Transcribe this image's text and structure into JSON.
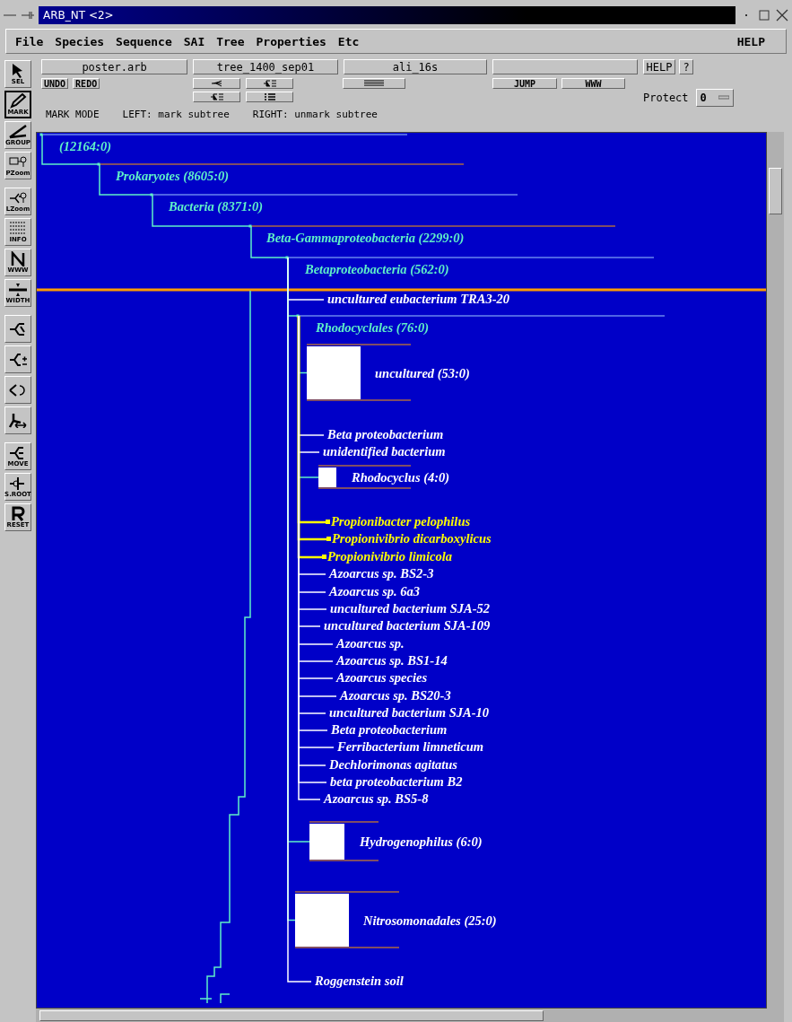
{
  "window": {
    "title": "ARB_NT <2>"
  },
  "menu": [
    {
      "label": "File"
    },
    {
      "label": "Species"
    },
    {
      "label": "Sequence"
    },
    {
      "label": "SAI"
    },
    {
      "label": "Tree"
    },
    {
      "label": "Properties"
    },
    {
      "label": "Etc"
    }
  ],
  "help_menu": "HELP",
  "tools": [
    {
      "kind": "select",
      "label": "SEL",
      "selected": false
    },
    {
      "kind": "mark",
      "label": "MARK",
      "selected": true
    },
    {
      "kind": "group",
      "label": "GROUP",
      "selected": false
    },
    {
      "kind": "pzoom",
      "label": "PZoom",
      "selected": false
    },
    {
      "kind": "lzoom",
      "label": "LZoom",
      "selected": false
    },
    {
      "kind": "info",
      "label": "INFO",
      "selected": false
    },
    {
      "kind": "www",
      "label": "WWW",
      "selected": false
    },
    {
      "kind": "width",
      "label": "WIDTH",
      "selected": false
    },
    {
      "kind": "swap",
      "selected": false
    },
    {
      "kind": "length",
      "selected": false
    },
    {
      "kind": "rotate",
      "selected": false
    },
    {
      "kind": "flip",
      "selected": false
    },
    {
      "kind": "move",
      "label": "MOVE",
      "selected": false
    },
    {
      "kind": "setroot",
      "label": "S.ROOT",
      "selected": false
    },
    {
      "kind": "reset",
      "label": "RESET",
      "selected": false
    }
  ],
  "toolbar": {
    "database": "poster.arb",
    "tree": "tree_1400_sep01",
    "alignment": "ali_16s",
    "help": "HELP",
    "question": "?",
    "undo": "UNDO",
    "redo": "REDO",
    "jump": "JUMP",
    "www": "WWW",
    "protect_label": "Protect",
    "protect_value": "0"
  },
  "status": {
    "mode": "MARK MODE",
    "left": "LEFT: mark subtree",
    "right": "RIGHT: unmark subtree"
  },
  "tree": {
    "kind": "group",
    "label": "(12164:0)",
    "children": [
      {
        "kind": "group",
        "label": "Prokaryotes (8605:0)",
        "children": [
          {
            "kind": "group",
            "label": "Bacteria (8371:0)",
            "children": [
              {
                "kind": "group",
                "label": "Beta-Gammaproteobacteria (2299:0)",
                "children": [
                  {
                    "kind": "group",
                    "label": "Betaproteobacteria (562:0)",
                    "children": [
                      {
                        "kind": "leaf",
                        "label": "uncultured eubacterium TRA3-20",
                        "marked": false
                      },
                      {
                        "kind": "group",
                        "label": "Rhodocyclales (76:0)",
                        "children": [
                          {
                            "kind": "collapsed",
                            "label": "uncultured (53:0)"
                          },
                          {
                            "kind": "leaf",
                            "label": "Beta proteobacterium",
                            "marked": false
                          },
                          {
                            "kind": "leaf",
                            "label": "unidentified bacterium",
                            "marked": false
                          },
                          {
                            "kind": "collapsed",
                            "label": "Rhodocyclus (4:0)"
                          },
                          {
                            "kind": "leaf",
                            "label": "Propionibacter pelophilus",
                            "marked": true
                          },
                          {
                            "kind": "leaf",
                            "label": "Propionivibrio dicarboxylicus",
                            "marked": true
                          },
                          {
                            "kind": "leaf",
                            "label": "Propionivibrio limicola",
                            "marked": true
                          },
                          {
                            "kind": "leaf",
                            "label": "Azoarcus sp. BS2-3",
                            "marked": false
                          },
                          {
                            "kind": "leaf",
                            "label": "Azoarcus sp. 6a3",
                            "marked": false
                          },
                          {
                            "kind": "leaf",
                            "label": "uncultured bacterium SJA-52",
                            "marked": false
                          },
                          {
                            "kind": "leaf",
                            "label": "uncultured bacterium SJA-109",
                            "marked": false
                          },
                          {
                            "kind": "leaf",
                            "label": "Azoarcus sp.",
                            "marked": false
                          },
                          {
                            "kind": "leaf",
                            "label": "Azoarcus sp. BS1-14",
                            "marked": false
                          },
                          {
                            "kind": "leaf",
                            "label": "Azoarcus species",
                            "marked": false
                          },
                          {
                            "kind": "leaf",
                            "label": "Azoarcus sp. BS20-3",
                            "marked": false
                          },
                          {
                            "kind": "leaf",
                            "label": "uncultured bacterium SJA-10",
                            "marked": false
                          },
                          {
                            "kind": "leaf",
                            "label": "Beta proteobacterium",
                            "marked": false
                          },
                          {
                            "kind": "leaf",
                            "label": "Ferribacterium limneticum",
                            "marked": false
                          },
                          {
                            "kind": "leaf",
                            "label": "Dechlorimonas agitatus",
                            "marked": false
                          },
                          {
                            "kind": "leaf",
                            "label": "beta proteobacterium B2",
                            "marked": false
                          },
                          {
                            "kind": "leaf",
                            "label": "Azoarcus sp. BS5-8",
                            "marked": false
                          }
                        ]
                      },
                      {
                        "kind": "collapsed",
                        "label": "Hydrogenophilus (6:0)"
                      },
                      {
                        "kind": "collapsed",
                        "label": "Nitrosomonadales (25:0)"
                      },
                      {
                        "kind": "leaf",
                        "label": "Roggenstein soil",
                        "marked": false
                      }
                    ]
                  }
                ]
              }
            ]
          }
        ]
      }
    ]
  }
}
